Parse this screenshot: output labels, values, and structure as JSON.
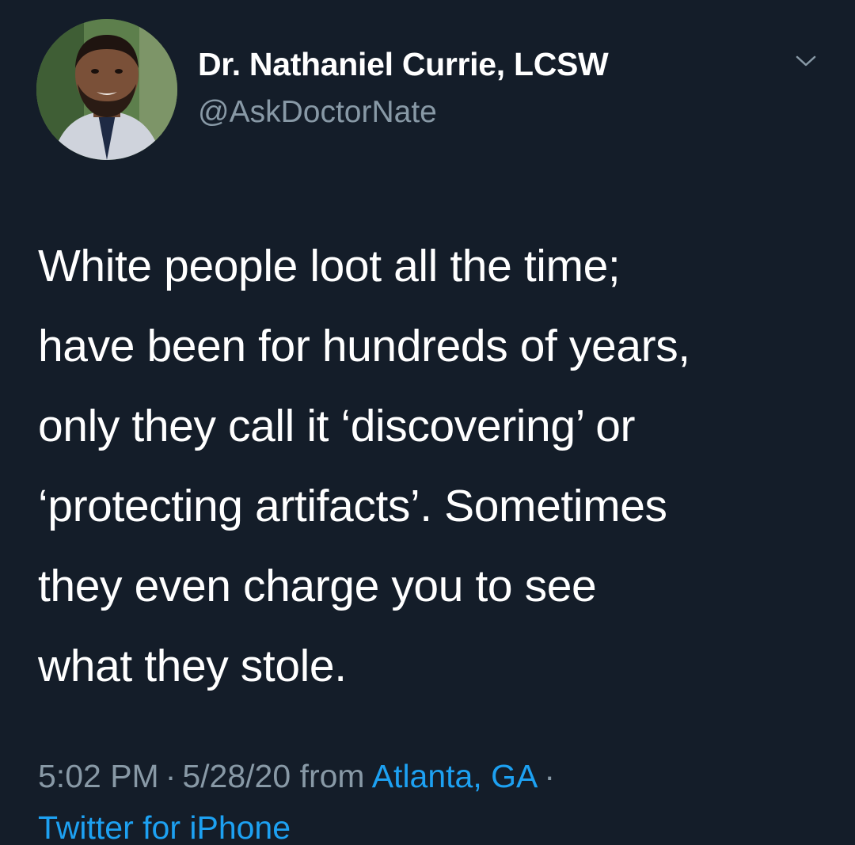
{
  "user": {
    "display_name": "Dr. Nathaniel Currie, LCSW",
    "handle": "@AskDoctorNate"
  },
  "icons": {
    "avatar": "profile-photo",
    "menu": "chevron-down-icon"
  },
  "tweet": {
    "lines": [
      "White people loot all the time;",
      "have been for hundreds of years,",
      "only they call it ‘discovering’ or",
      "‘protecting artifacts’. Sometimes",
      "they even charge you to see",
      "what they stole."
    ]
  },
  "meta": {
    "time": "5:02 PM",
    "date": "5/28/20",
    "from_label": "from",
    "location": "Atlanta, GA",
    "separator": "·",
    "source": "Twitter for iPhone"
  },
  "colors": {
    "background": "#141d29",
    "text": "#ffffff",
    "secondary": "#8899a6",
    "link": "#1da1f2"
  }
}
